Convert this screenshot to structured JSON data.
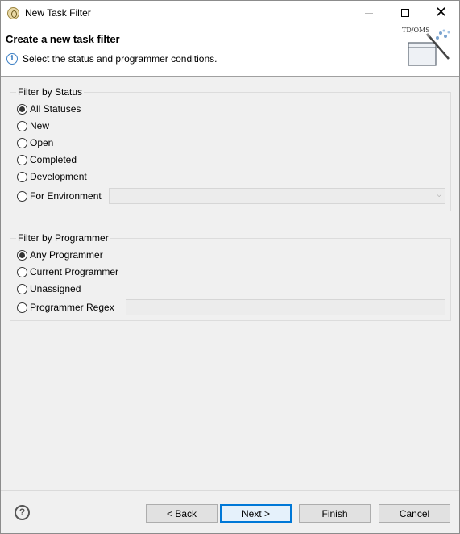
{
  "window": {
    "title": "New Task Filter",
    "min_label": "—",
    "close_label": "✕"
  },
  "banner": {
    "title": "Create a new task filter",
    "message": "Select the status and programmer conditions.",
    "info_glyph": "i",
    "logo_text": "TD/OMS"
  },
  "status_group": {
    "legend": "Filter by Status",
    "options": [
      {
        "label": "All Statuses",
        "checked": true
      },
      {
        "label": "New",
        "checked": false
      },
      {
        "label": "Open",
        "checked": false
      },
      {
        "label": "Completed",
        "checked": false
      },
      {
        "label": "Development",
        "checked": false
      },
      {
        "label": "For Environment",
        "checked": false
      }
    ],
    "environment_value": "",
    "combo_arrow": "⌵"
  },
  "programmer_group": {
    "legend": "Filter by Programmer",
    "options": [
      {
        "label": "Any Programmer",
        "checked": true
      },
      {
        "label": "Current Programmer",
        "checked": false
      },
      {
        "label": "Unassigned",
        "checked": false
      },
      {
        "label": "Programmer Regex",
        "checked": false
      }
    ],
    "regex_value": ""
  },
  "footer": {
    "help_glyph": "?",
    "back_label": "< Back",
    "next_label": "Next >",
    "finish_label": "Finish",
    "cancel_label": "Cancel"
  },
  "colors": {
    "default_button_border": "#0078d7",
    "info_icon": "#3c7fc4",
    "background": "#f0f0f0"
  },
  "icons": [
    "app-icon",
    "minimize-icon",
    "maximize-icon",
    "close-icon",
    "info-icon",
    "wizard-banner-icon",
    "dropdown-arrow-icon",
    "help-icon"
  ]
}
